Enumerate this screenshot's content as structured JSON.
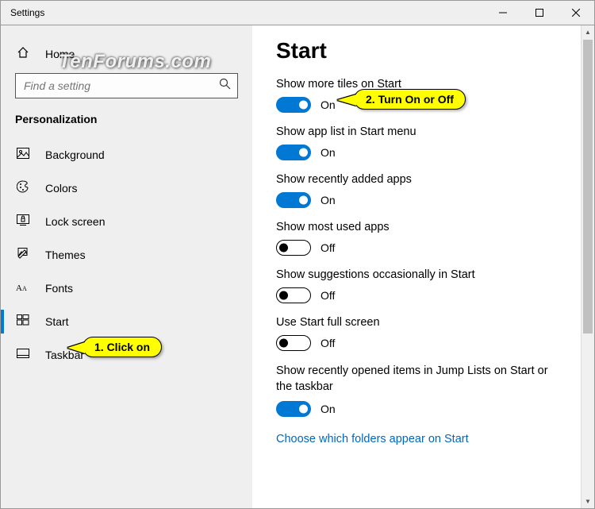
{
  "window": {
    "title": "Settings"
  },
  "watermark": "TenForums.com",
  "sidebar": {
    "home": "Home",
    "search_placeholder": "Find a setting",
    "category": "Personalization",
    "items": [
      {
        "label": "Background"
      },
      {
        "label": "Colors"
      },
      {
        "label": "Lock screen"
      },
      {
        "label": "Themes"
      },
      {
        "label": "Fonts"
      },
      {
        "label": "Start"
      },
      {
        "label": "Taskbar"
      }
    ]
  },
  "main": {
    "heading": "Start",
    "settings": [
      {
        "label": "Show more tiles on Start",
        "on": true,
        "state": "On"
      },
      {
        "label": "Show app list in Start menu",
        "on": true,
        "state": "On"
      },
      {
        "label": "Show recently added apps",
        "on": true,
        "state": "On"
      },
      {
        "label": "Show most used apps",
        "on": false,
        "state": "Off"
      },
      {
        "label": "Show suggestions occasionally in Start",
        "on": false,
        "state": "Off"
      },
      {
        "label": "Use Start full screen",
        "on": false,
        "state": "Off"
      },
      {
        "label": "Show recently opened items in Jump Lists on Start or the taskbar",
        "on": true,
        "state": "On"
      }
    ],
    "link": "Choose which folders appear on Start"
  },
  "callouts": {
    "c1": "1. Click on",
    "c2": "2. Turn On or Off"
  }
}
